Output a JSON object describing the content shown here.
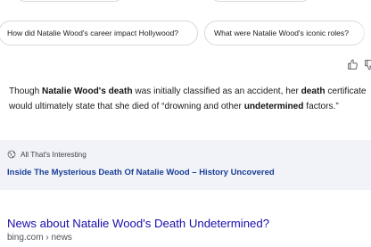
{
  "related_questions": [
    {
      "label": "How did Natalie Wood's career impact Hollywood?"
    },
    {
      "label": "What were Natalie Wood's iconic roles?"
    }
  ],
  "feedback": {
    "thumbs_up": "thumbs-up-icon",
    "thumbs_down": "thumbs-down-icon"
  },
  "answer": {
    "t1": "Though ",
    "b1": "Natalie Wood's death",
    "t2": " was initially classified as an accident, her ",
    "b2": "death",
    "t3": " certificate would ultimately state that she died of “drowning and other ",
    "b3": "undetermined",
    "t4": " factors.”"
  },
  "source": {
    "site_name": "All That's Interesting",
    "title": "Inside The Mysterious Death Of Natalie Wood – History Uncovered",
    "icon": "globe-icon"
  },
  "result": {
    "title": "News about Natalie Wood's Death Undetermined?",
    "url": "bing.com › news"
  },
  "colors": {
    "link": "#1a0dab",
    "source_link": "#1a3e96",
    "card_bg": "#f1f3f9",
    "chip_border": "#d6d9de"
  }
}
